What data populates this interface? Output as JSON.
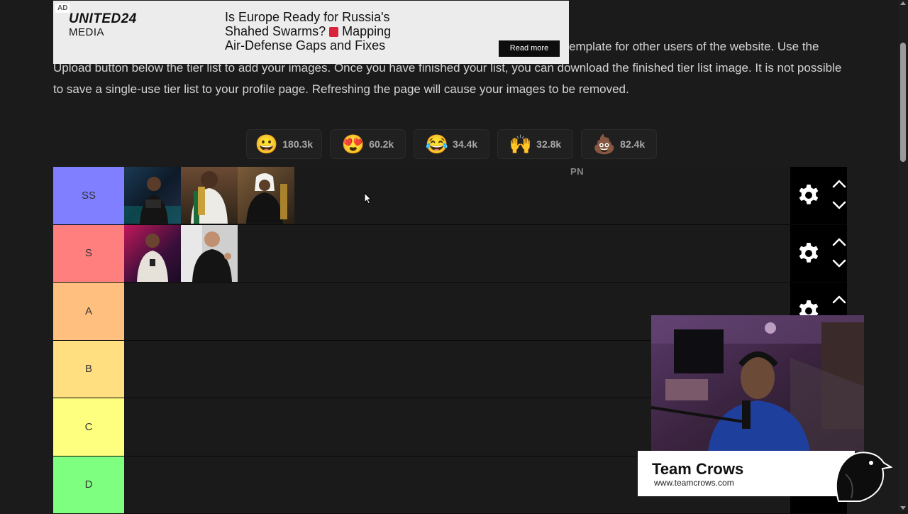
{
  "intro": {
    "line1": "emplate for other users of the website. Use the",
    "line2": "Upload button below the tier list to add your images. Once you have finished your list, you can download the finished tier list image. It is not possible",
    "line3": "to save a single-use tier list to your profile page. Refreshing the page will cause your images to be removed."
  },
  "ad": {
    "tag": "AD",
    "logo_line1": "UNITED24",
    "logo_line2": "MEDIA",
    "headline_1": "Is Europe Ready for Russia's",
    "headline_2": "Shahed Swarms?",
    "headline_3": "Mapping",
    "headline_4": "Air-Defense Gaps and Fixes",
    "button": "Read more"
  },
  "reactions": [
    {
      "emoji": "😀",
      "count": "180.3k",
      "icon": "grinning-face-icon"
    },
    {
      "emoji": "😍",
      "count": "60.2k",
      "icon": "heart-eyes-icon"
    },
    {
      "emoji": "😂",
      "count": "34.4k",
      "icon": "tears-of-joy-icon"
    },
    {
      "emoji": "🙌",
      "count": "32.8k",
      "icon": "raised-hands-icon"
    },
    {
      "emoji": "💩",
      "count": "82.4k",
      "icon": "pile-of-poo-icon"
    }
  ],
  "tiers": [
    {
      "label": "SS",
      "color": "#7f7fff",
      "items": 3
    },
    {
      "label": "S",
      "color": "#ff7f7f",
      "items": 2
    },
    {
      "label": "A",
      "color": "#ffbf7f",
      "items": 0
    },
    {
      "label": "B",
      "color": "#ffdf7f",
      "items": 0
    },
    {
      "label": "C",
      "color": "#ffff7f",
      "items": 0
    },
    {
      "label": "D",
      "color": "#7fff7f",
      "items": 0
    }
  ],
  "overlay_text": "PN",
  "stream_banner": {
    "title": "Team Crows",
    "url": "www.teamcrows.com"
  }
}
